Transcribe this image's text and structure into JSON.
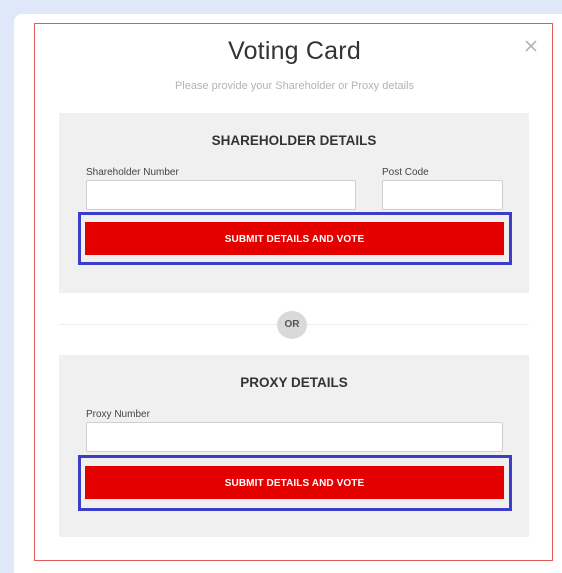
{
  "modal": {
    "title": "Voting Card",
    "subtitle": "Please provide your Shareholder or Proxy details",
    "close_icon": "close-icon",
    "move_icon": "move-handle-icon"
  },
  "shareholder": {
    "heading": "SHAREHOLDER DETAILS",
    "number_label": "Shareholder Number",
    "number_value": "",
    "postcode_label": "Post Code",
    "postcode_value": "",
    "submit_label": "SUBMIT DETAILS AND VOTE"
  },
  "divider": {
    "or_label": "OR"
  },
  "proxy": {
    "heading": "PROXY DETAILS",
    "number_label": "Proxy Number",
    "number_value": "",
    "submit_label": "SUBMIT DETAILS AND VOTE"
  },
  "colors": {
    "submit_bg": "#e50000",
    "highlight_border": "#3a3ec9",
    "modal_border": "#e25a5a",
    "page_bg": "#dfe8f9"
  }
}
